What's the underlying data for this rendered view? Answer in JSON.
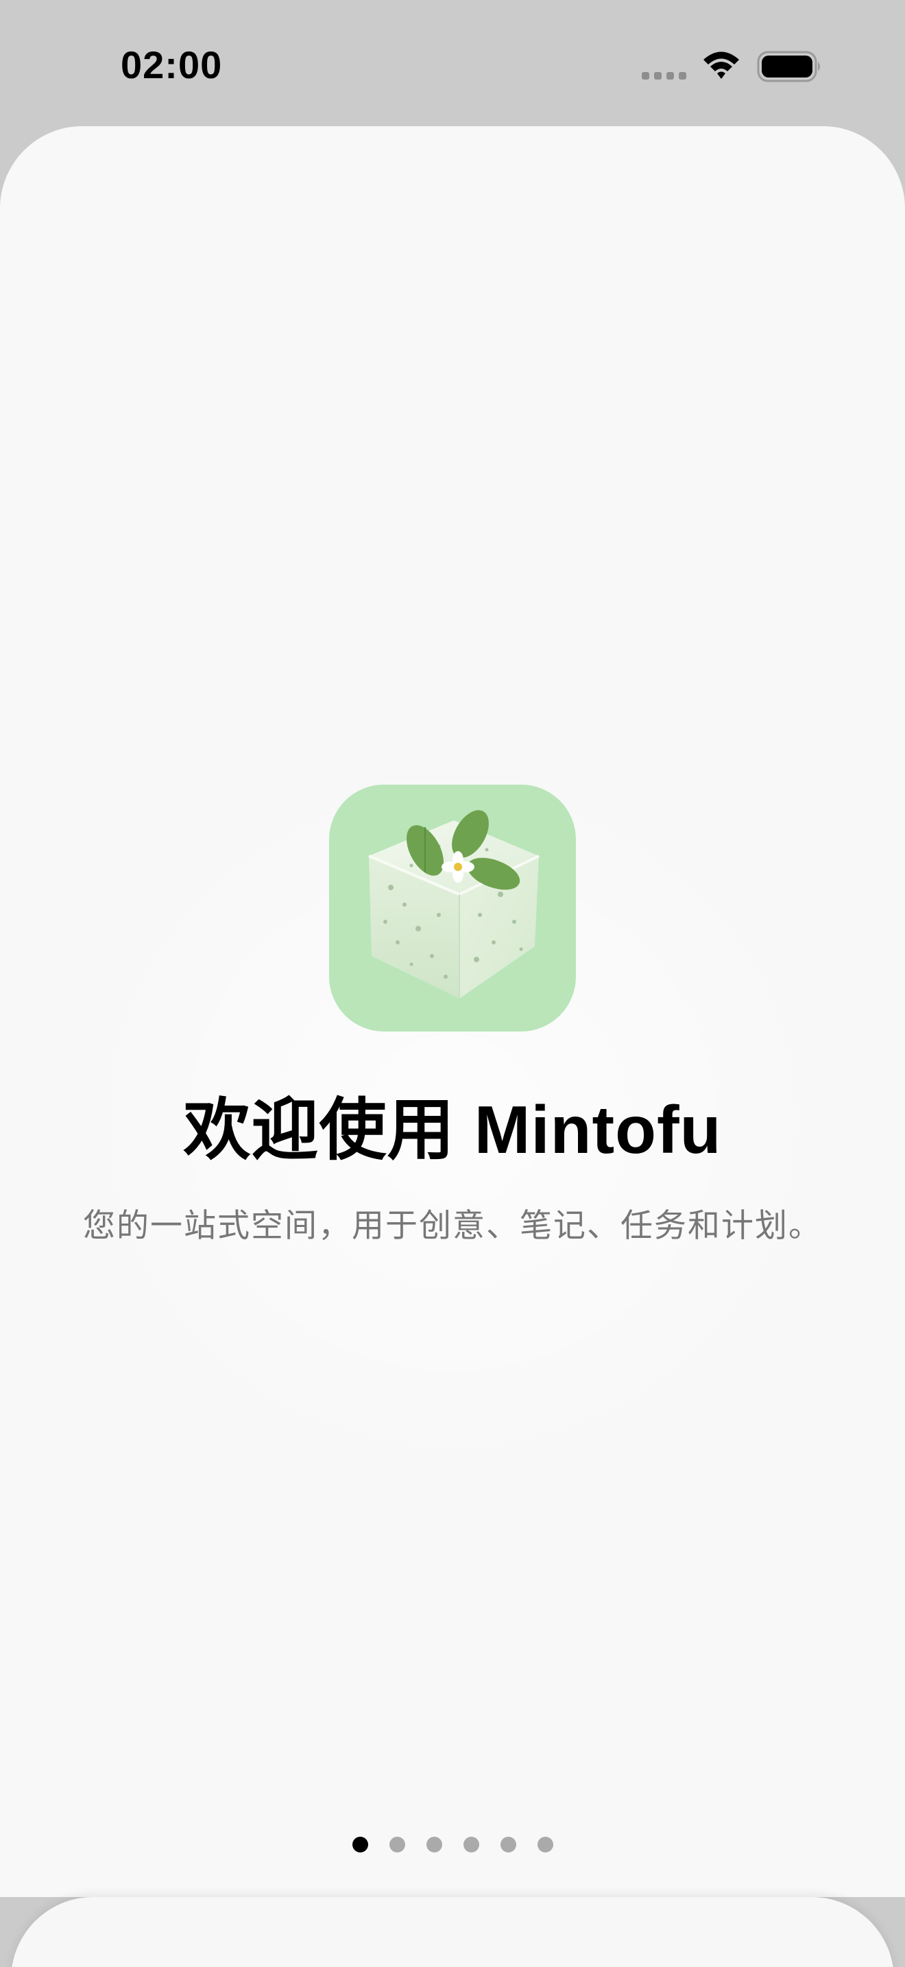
{
  "status_bar": {
    "time": "02:00",
    "icons": [
      "signal-dots-icon",
      "wifi-icon",
      "battery-icon"
    ]
  },
  "onboarding": {
    "title": "欢迎使用 Mintofu",
    "subtitle": "您的一站式空间，用于创意、笔记、任务和计划。",
    "app_icon": "mintofu-tofu-logo",
    "page_count": 6,
    "current_page": 1
  },
  "colors": {
    "background": "#f8f8f8",
    "status_bar": "#cbcbcb",
    "icon_bg": "#b9e5b9",
    "title": "#000000",
    "subtitle": "#777777",
    "dot_active": "#000000",
    "dot_inactive": "#aaaaaa"
  }
}
